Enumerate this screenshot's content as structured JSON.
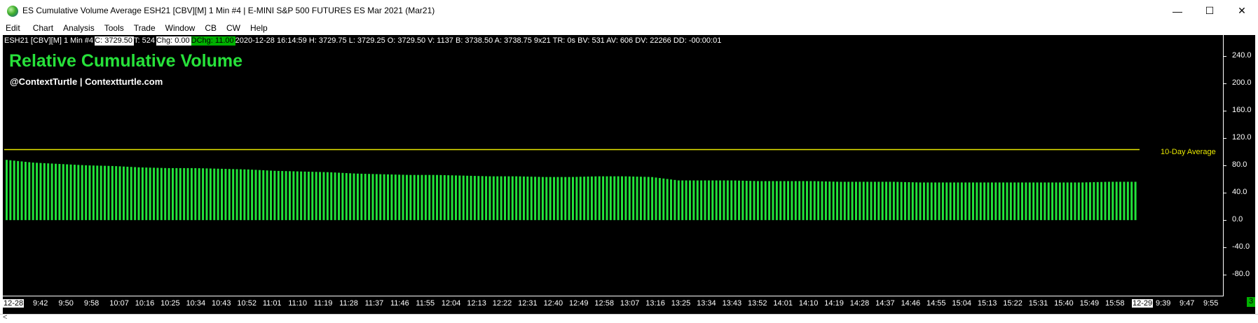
{
  "window": {
    "title": "ES Cumulative Volume Average ESH21 [CBV][M]  1 Min   #4 | E-MINI S&P 500 FUTURES ES Mar 2021 (Mar21)",
    "minimize_glyph": "—",
    "maximize_glyph": "☐",
    "close_glyph": "✕",
    "icon": "app-globe-icon"
  },
  "menu": [
    "Edit",
    "Chart",
    "Analysis",
    "Tools",
    "Trade",
    "Window",
    "CB",
    "CW",
    "Help"
  ],
  "infoline": {
    "symbol": "ESH21 [CBV][M]  1 Min   #4",
    "close": "C: 3729.50",
    "ticks": "T: 524",
    "chg": "Chg: 0.00",
    "dchg": "DChg: 11.00",
    "rest": "2020-12-28 16:14:59 H: 3729.75 L: 3729.25 O: 3729.50 V: 1137 B: 3738.50 A: 3738.75 9x21 TR: 0s BV: 531 AV: 606 DV: 22266 DD: -00:00:01"
  },
  "study": {
    "title": "Relative Cumulative Volume",
    "subtitle": "@ContextTurtle | Contextturtle.com",
    "avg_label": "10-Day Average"
  },
  "colors": {
    "background": "#000000",
    "bars": "#22e33a",
    "average_line": "#e8e800",
    "title": "#27e23a"
  },
  "chart_data": {
    "type": "bar",
    "series": [
      {
        "name": "10-Day Average",
        "kind": "line",
        "value": 103
      },
      {
        "name": "Relative Cumulative Volume",
        "kind": "bar"
      }
    ],
    "bar_values_sampled": [
      88,
      84,
      82,
      80,
      79,
      77,
      76,
      76,
      75,
      74,
      72,
      71,
      70,
      68,
      67,
      66,
      66,
      65,
      64,
      64,
      63,
      63,
      64,
      64,
      63,
      58,
      58,
      58,
      57,
      57,
      57,
      56,
      56,
      56,
      55,
      55,
      55,
      55,
      55,
      55,
      55,
      56,
      56
    ],
    "bar_count": 300,
    "ylim": [
      -95,
      255
    ],
    "yticks": [
      "240.0",
      "200.0",
      "160.0",
      "120.0",
      "80.0",
      "40.0",
      "0.0",
      "-40.0",
      "-80.0"
    ],
    "ytick_values": [
      240,
      200,
      160,
      120,
      80,
      40,
      0,
      -40,
      -80
    ],
    "xticks": [
      "12-28",
      "9:42",
      "9:50",
      "9:58",
      "10:07",
      "10:16",
      "10:25",
      "10:34",
      "10:43",
      "10:52",
      "11:01",
      "11:10",
      "11:19",
      "11:28",
      "11:37",
      "11:46",
      "11:55",
      "12:04",
      "12:13",
      "12:22",
      "12:31",
      "12:40",
      "12:49",
      "12:58",
      "13:07",
      "13:16",
      "13:25",
      "13:34",
      "13:43",
      "13:52",
      "14:01",
      "14:10",
      "14:19",
      "14:28",
      "14:37",
      "14:46",
      "14:55",
      "15:04",
      "15:13",
      "15:22",
      "15:31",
      "15:40",
      "15:49",
      "15:58",
      "12-29",
      "9:39",
      "9:47",
      "9:55"
    ],
    "grid": false
  },
  "badge": "3"
}
